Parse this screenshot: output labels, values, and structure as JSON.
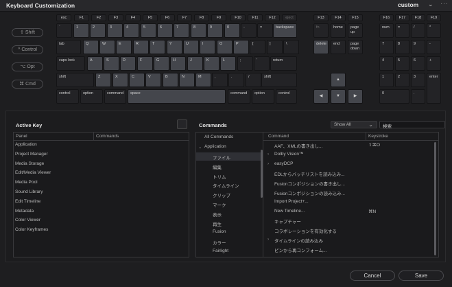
{
  "window": {
    "title": "Keyboard Customization",
    "preset": "custom",
    "preset_chevron_icon": "chevron-down-icon",
    "more_icon": "ellipsis-icon"
  },
  "modifiers": [
    {
      "label": "⇧ Shift"
    },
    {
      "label": "^ Control"
    },
    {
      "label": "⌥ Opt"
    },
    {
      "label": "⌘ Cmd"
    }
  ],
  "keyboard": {
    "function_row": [
      "esc",
      "F1",
      "F2",
      "F3",
      "F4",
      "F5",
      "F6",
      "F7",
      "F8",
      "F9",
      "F10",
      "F11",
      "F12",
      "eject"
    ],
    "number_row": [
      "`",
      "1",
      "2",
      "3",
      "4",
      "5",
      "6",
      "7",
      "8",
      "9",
      "0",
      "-",
      "="
    ],
    "backspace": "backspace",
    "qwerty_row": [
      "tab",
      "Q",
      "W",
      "E",
      "R",
      "T",
      "Y",
      "U",
      "I",
      "O",
      "P",
      "[",
      "]",
      "\\"
    ],
    "home_row": [
      "caps lock",
      "A",
      "S",
      "D",
      "F",
      "G",
      "H",
      "J",
      "K",
      "L",
      ";",
      "'",
      "return"
    ],
    "shift_row": [
      "shift",
      "Z",
      "X",
      "C",
      "V",
      "B",
      "N",
      "M",
      ",",
      ".",
      "/",
      "shift"
    ],
    "bottom_row": [
      "control",
      "option",
      "command",
      "space",
      "command",
      "option",
      "control"
    ],
    "nav_fn": [
      "F13",
      "F14",
      "F15"
    ],
    "nav_top": [
      "fn",
      "home",
      "page up"
    ],
    "nav_mid": [
      "delete",
      "end",
      "page down"
    ],
    "arrows": {
      "up": "▲",
      "left": "◀",
      "down": "▼",
      "right": "▶"
    },
    "numpad_fn": [
      "F16",
      "F17",
      "F18",
      "F19"
    ],
    "numpad": [
      [
        "num",
        "=",
        "/",
        "*"
      ],
      [
        "7",
        "8",
        "9",
        "-"
      ],
      [
        "4",
        "5",
        "6",
        "+"
      ],
      [
        "1",
        "2",
        "3",
        "enter"
      ],
      [
        "0",
        "."
      ]
    ],
    "key_counts": {
      "backspace": "1",
      "delete": "3",
      "i": "1",
      "o": "1"
    }
  },
  "active_key": {
    "heading": "Active Key",
    "columns": [
      "Panel",
      "Commands"
    ],
    "panels": [
      "Application",
      "Project Manager",
      "Media Storage",
      "Edit/Media Viewer",
      "Media Pool",
      "Sound Library",
      "Edit Timeline",
      "Metadata",
      "Color Viewer",
      "Color Keyframes"
    ]
  },
  "commands": {
    "heading": "Commands",
    "filter": "Show All",
    "search_value": "検索",
    "tree": {
      "all": "All Commands",
      "application": "Application",
      "children": [
        "ファイル",
        "編集",
        "トリム",
        "タイムライン",
        "クリップ",
        "マーク",
        "表示",
        "再生",
        "Fusion",
        "カラー",
        "Fairlight"
      ]
    },
    "columns": [
      "Command",
      "Keystroke"
    ],
    "rows": [
      {
        "name": "AAF、XMLの書き出し...",
        "keys": "⇧⌘O",
        "expandable": false
      },
      {
        "name": "Dolby Vision™",
        "keys": "",
        "expandable": true
      },
      {
        "name": "easyDCP",
        "keys": "",
        "expandable": true
      },
      {
        "name": "EDLからバッチリストを読み込み...",
        "keys": "",
        "expandable": false
      },
      {
        "name": "Fusionコンポジションの書き出し...",
        "keys": "",
        "expandable": false
      },
      {
        "name": "Fusionコンポジションの読み込み...",
        "keys": "",
        "expandable": false
      },
      {
        "name": "Import Project+...",
        "keys": "",
        "expandable": false
      },
      {
        "name": "New Timeline...",
        "keys": "⌘N",
        "expandable": false
      },
      {
        "name": "キャプチャー",
        "keys": "",
        "expandable": false
      },
      {
        "name": "コラボレーションを有効化する",
        "keys": "",
        "expandable": false
      },
      {
        "name": "タイムラインの読み込み",
        "keys": "",
        "expandable": true
      },
      {
        "name": "ピンから再コンフォーム...",
        "keys": "",
        "expandable": false
      }
    ]
  },
  "footer": {
    "cancel": "Cancel",
    "save": "Save"
  }
}
